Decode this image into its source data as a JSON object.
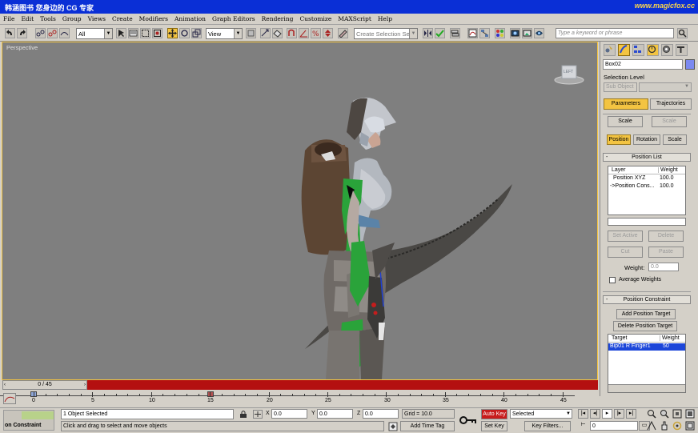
{
  "window": {
    "title": "韩涵图书  您身边的 CG 专家",
    "brand": "www.magicfox.cc"
  },
  "menu": [
    "File",
    "Edit",
    "Tools",
    "Group",
    "Views",
    "Create",
    "Modifiers",
    "Animation",
    "Graph Editors",
    "Rendering",
    "Customize",
    "MAXScript",
    "Help"
  ],
  "toolbar": {
    "selection_filter": "All",
    "ref_coord": "View",
    "named_selection_placeholder": "Create Selection Set",
    "search_placeholder": "Type a keyword or phrase"
  },
  "viewport": {
    "label": "Perspective",
    "viewcube_label": "LEFT"
  },
  "command_panel": {
    "object_name": "Box02",
    "selection_level_label": "Selection Level",
    "sub_object": "Sub Object",
    "tab_parameters": "Parameters",
    "tab_trajectories": "Trajectories",
    "scale_btn_1": "Scale",
    "scale_btn_2": "Scale",
    "position_btn": "Position",
    "rotation_btn": "Rotation",
    "scale_btn_3": "Scale",
    "position_list_title": "Position List",
    "col_layer": "Layer",
    "col_weight": "Weight",
    "layers": [
      {
        "name": "Position XYZ",
        "weight": "100.0"
      },
      {
        "name": "->Position Cons...",
        "weight": "100.0"
      }
    ],
    "set_active": "Set Active",
    "delete": "Delete",
    "cut": "Cut",
    "paste": "Paste",
    "weight_label": "Weight:",
    "weight_value": "0.0",
    "average_weights": "Average Weights",
    "position_constraint_title": "Position Constraint",
    "add_position_target": "Add Position Target",
    "delete_position_target": "Delete Position Target",
    "col_target": "Target",
    "col_target_weight": "Weight",
    "targets": [
      {
        "name": "Bip01 R Finger1",
        "weight": "50"
      }
    ]
  },
  "timeline": {
    "slider_label": "0 / 45",
    "ticks": [
      "0",
      "5",
      "10",
      "15",
      "20",
      "25",
      "30",
      "35",
      "40",
      "45"
    ]
  },
  "status": {
    "left_label": "on Constraint",
    "objects_selected": "1 Object Selected",
    "prompt": "Click and drag to select and move objects",
    "x_label": "X",
    "x_value": "0.0",
    "y_label": "Y",
    "y_value": "0.0",
    "z_label": "Z",
    "z_value": "0.0",
    "grid": "Grid = 10.0",
    "add_time_tag": "Add Time Tag",
    "auto_key": "Auto Key",
    "set_key": "Set Key",
    "key_mode": "Selected",
    "key_filters": "Key Filters...",
    "current_frame": "0"
  }
}
